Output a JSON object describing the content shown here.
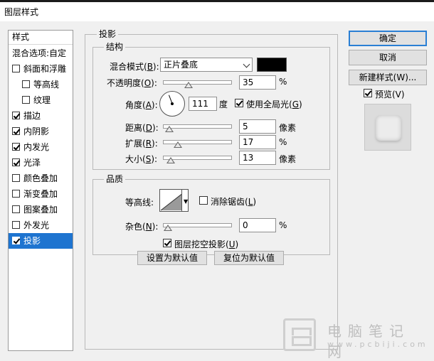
{
  "window": {
    "title": "图层样式"
  },
  "sidebar": {
    "header": "样式",
    "blend_options": "混合选项:自定",
    "items": [
      {
        "label": "斜面和浮雕",
        "checked": false,
        "indent": false
      },
      {
        "label": "等高线",
        "checked": false,
        "indent": true
      },
      {
        "label": "纹理",
        "checked": false,
        "indent": true
      },
      {
        "label": "描边",
        "checked": true,
        "indent": false
      },
      {
        "label": "内阴影",
        "checked": true,
        "indent": false
      },
      {
        "label": "内发光",
        "checked": true,
        "indent": false
      },
      {
        "label": "光泽",
        "checked": true,
        "indent": false
      },
      {
        "label": "颜色叠加",
        "checked": false,
        "indent": false
      },
      {
        "label": "渐变叠加",
        "checked": false,
        "indent": false
      },
      {
        "label": "图案叠加",
        "checked": false,
        "indent": false
      },
      {
        "label": "外发光",
        "checked": false,
        "indent": false
      },
      {
        "label": "投影",
        "checked": true,
        "indent": false,
        "selected": true
      }
    ]
  },
  "main": {
    "section_title": "投影",
    "structure": {
      "title": "结构",
      "blend_mode_label": "混合模式(",
      "blend_mode_key": "B",
      "blend_mode_value": "正片叠底",
      "shadow_color": "#000000",
      "opacity_label": "不透明度(",
      "opacity_key": "O",
      "opacity_value": "35",
      "percent": "%",
      "angle_label": "角度(",
      "angle_key": "A",
      "angle_value": "111",
      "angle_unit": "度",
      "global_light_label": "使用全局光(",
      "global_light_key": "G",
      "global_light_checked": true,
      "distance_label": "距离(",
      "distance_key": "D",
      "distance_value": "5",
      "px_unit": "像素",
      "spread_label": "扩展(",
      "spread_key": "R",
      "spread_value": "17",
      "size_label": "大小(",
      "size_key": "S",
      "size_value": "13",
      "close_paren": "):"
    },
    "quality": {
      "title": "品质",
      "contour_label": "等高线:",
      "antialias_label": "消除锯齿(",
      "antialias_key": "L",
      "antialias_checked": false,
      "noise_label": "杂色(",
      "noise_key": "N",
      "noise_value": "0"
    },
    "knockout_label": "图层挖空投影(",
    "knockout_key": "U",
    "knockout_checked": true,
    "set_default_btn": "设置为默认值",
    "reset_default_btn": "复位为默认值"
  },
  "right": {
    "ok_btn": "确定",
    "cancel_btn": "取消",
    "new_style_btn": "新建样式(W)...",
    "preview_label": "预览(V)",
    "preview_checked": true
  },
  "watermark": {
    "name": "电脑笔记网",
    "url": "www.pcbiji.com"
  },
  "close_paren_short": ")"
}
